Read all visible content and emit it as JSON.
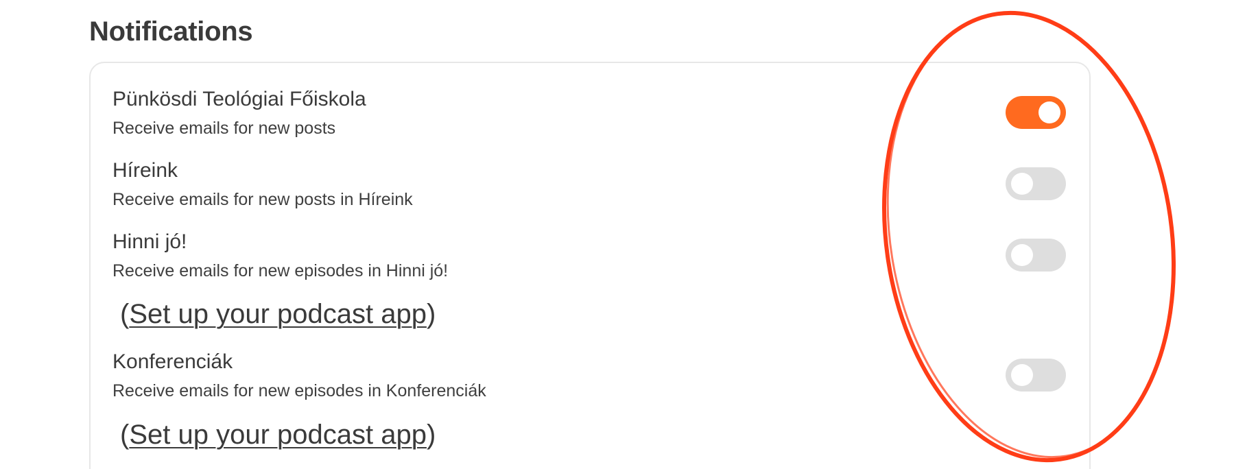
{
  "page": {
    "title": "Notifications"
  },
  "notifications": [
    {
      "title": "Pünkösdi Teológiai Főiskola",
      "description": "Receive emails for new posts",
      "enabled": true
    },
    {
      "title": "Híreink",
      "description": "Receive emails for new posts in Híreink",
      "enabled": false
    },
    {
      "title": "Hinni jó!",
      "description": "Receive emails for new episodes in Hinni jó!",
      "enabled": false,
      "podcast_link": "Set up your podcast app"
    },
    {
      "title": "Konferenciák",
      "description": "Receive emails for new episodes in Konferenciák",
      "enabled": false,
      "podcast_link": "Set up your podcast app"
    }
  ],
  "colors": {
    "toggle_on": "#ff6a1f",
    "toggle_off": "#dedede",
    "annotation_circle": "#ff3d17"
  }
}
